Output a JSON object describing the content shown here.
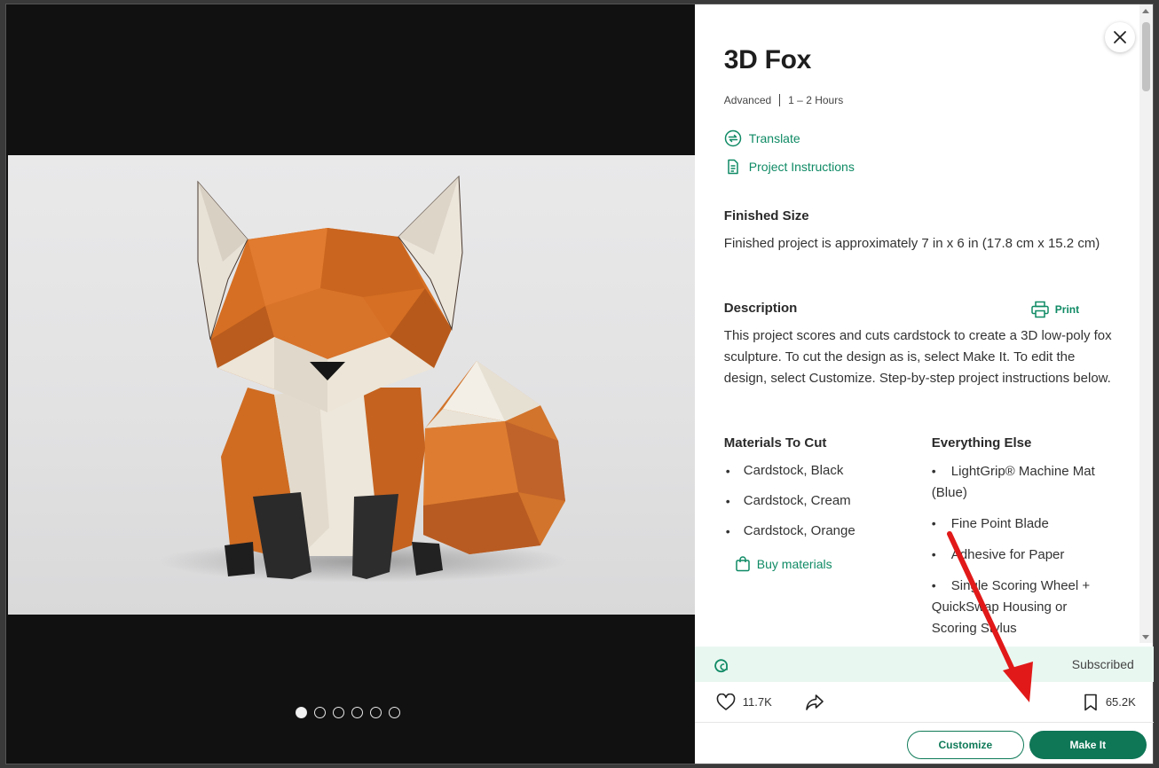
{
  "project": {
    "title": "3D Fox",
    "level": "Advanced",
    "duration": "1 – 2 Hours"
  },
  "links": {
    "translate": "Translate",
    "instructions": "Project Instructions",
    "print": "Print",
    "buy_materials": "Buy materials"
  },
  "finished_size": {
    "heading": "Finished Size",
    "text": "Finished project is approximately 7 in x 6 in (17.8 cm x 15.2 cm)"
  },
  "description": {
    "heading": "Description",
    "text": "This project scores and cuts cardstock to create a 3D low-poly fox sculpture. To cut the design as is, select Make It. To edit the design, select Customize. Step-by-step project instructions below."
  },
  "materials_to_cut": {
    "heading": "Materials To Cut",
    "items": [
      "Cardstock, Black",
      "Cardstock, Cream",
      "Cardstock, Orange"
    ]
  },
  "everything_else": {
    "heading": "Everything Else",
    "items": [
      "LightGrip® Machine Mat (Blue)",
      "Fine Point Blade",
      "Adhesive for Paper",
      "Single Scoring Wheel + QuickSwap Housing or Scoring Stylus"
    ]
  },
  "subscription": {
    "status": "Subscribed"
  },
  "stats": {
    "likes": "11.7K",
    "saves": "65.2K"
  },
  "actions": {
    "customize": "Customize",
    "make_it": "Make It"
  },
  "gallery": {
    "slide_count": 6,
    "active_index": 0
  },
  "colors": {
    "accent": "#0f7656",
    "link": "#0f8a64",
    "annotation_arrow": "#e11919"
  }
}
